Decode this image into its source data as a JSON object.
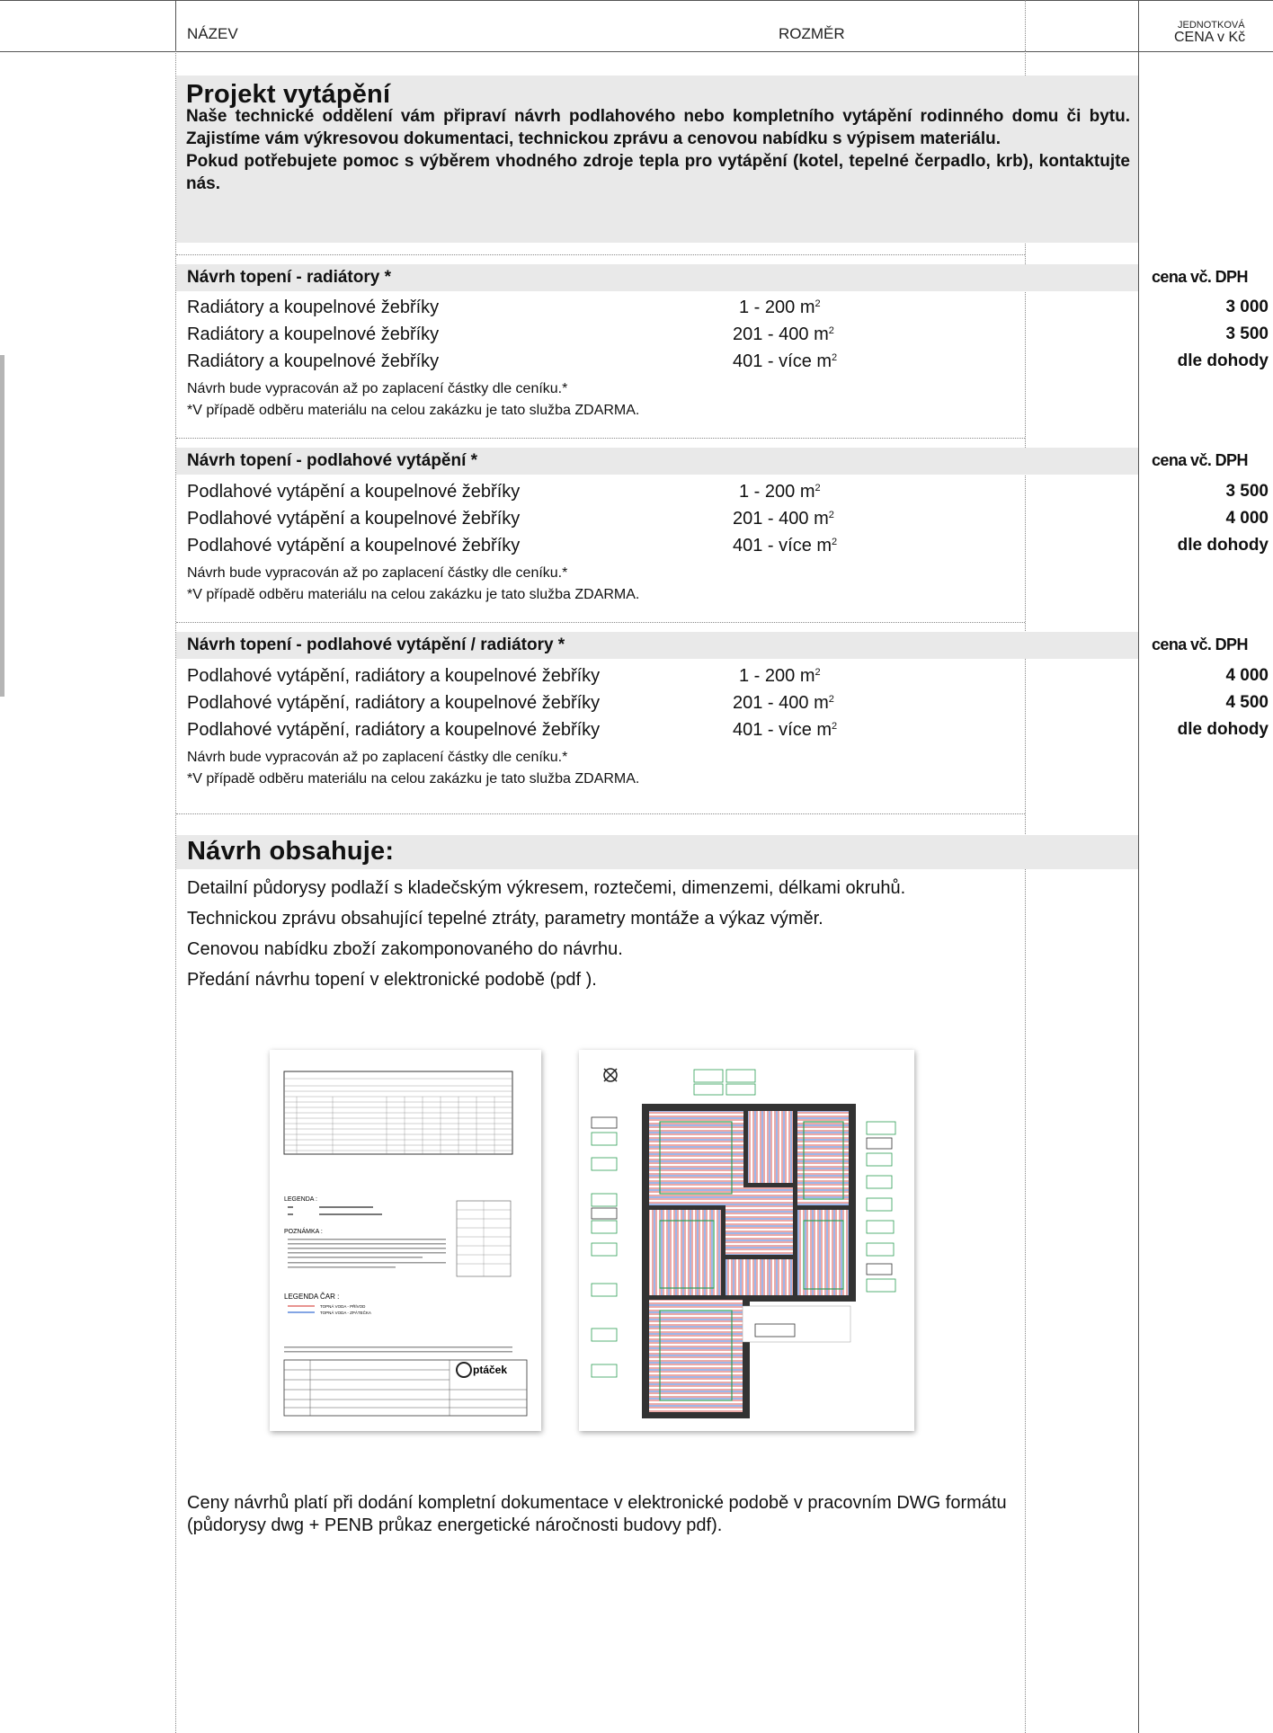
{
  "header": {
    "col_name": "NÁZEV",
    "col_size": "ROZMĚR",
    "col_price_line1": "JEDNOTKOVÁ",
    "col_price_line2": "CENA v Kč"
  },
  "project": {
    "title": "Projekt vytápění",
    "intro_p1": "Naše technické oddělení vám připraví návrh podlahového nebo kompletního vytápění rodinného domu či bytu. Zajistíme vám výkresovou dokumentaci, technickou zprávu a cenovou nabídku s výpisem materiálu.",
    "intro_p2": "Pokud potřebujete pomoc s výběrem vhodného zdroje tepla pro vytápění (kotel, tepelné čerpadlo, krb), kontaktujte nás."
  },
  "sections": [
    {
      "title": "Návrh topení - radiátory *",
      "price_header": "cena vč. DPH",
      "rows": [
        {
          "name": "Radiátory a koupelnové žebříky",
          "size": "1 - 200 m",
          "price": "3 000"
        },
        {
          "name": "Radiátory a koupelnové žebříky",
          "size": "201 - 400 m",
          "price": "3 500"
        },
        {
          "name": "Radiátory a koupelnové žebříky",
          "size": "401 - více m",
          "price": "dle dohody"
        }
      ],
      "note1": "Návrh bude vypracován až po zaplacení částky dle ceníku.*",
      "note2": "*V případě odběru materiálu na celou zakázku je tato služba ZDARMA."
    },
    {
      "title": "Návrh topení - podlahové vytápění *",
      "price_header": "cena vč. DPH",
      "rows": [
        {
          "name": "Podlahové vytápění a koupelnové žebříky",
          "size": "1 - 200 m",
          "price": "3 500"
        },
        {
          "name": "Podlahové vytápění a koupelnové žebříky",
          "size": "201 - 400 m",
          "price": "4 000"
        },
        {
          "name": "Podlahové vytápění a koupelnové žebříky",
          "size": "401 - více m",
          "price": "dle dohody"
        }
      ],
      "note1": "Návrh bude vypracován až po zaplacení částky dle ceníku.*",
      "note2": "*V případě odběru materiálu na celou zakázku je tato služba ZDARMA."
    },
    {
      "title": "Návrh topení - podlahové vytápění / radiátory *",
      "price_header": "cena vč. DPH",
      "rows": [
        {
          "name": "Podlahové vytápění, radiátory a koupelnové žebříky",
          "size": "1 - 200 m",
          "price": "4 000"
        },
        {
          "name": "Podlahové vytápění, radiátory a koupelnové žebříky",
          "size": "201 - 400 m",
          "price": "4 500"
        },
        {
          "name": "Podlahové vytápění, radiátory a koupelnové žebříky",
          "size": "401 - více m",
          "price": "dle dohody"
        }
      ],
      "note1": "Návrh bude vypracován až po zaplacení částky dle ceníku.*",
      "note2": "*V případě odběru materiálu na celou zakázku je tato služba ZDARMA."
    }
  ],
  "unit_superscript": "2",
  "contents": {
    "title": "Návrh obsahuje:",
    "items": [
      "Detailní půdorysy podlaží s kladečským výkresem, roztečemi, dimenzemi, délkami okruhů.",
      "Technickou zprávu obsahující tepelné ztráty, parametry montáže a výkaz výměr.",
      "Cenovou nabídku zboží zakomponovaného do návrhu.",
      "Předání návrhu topení v elektronické podobě (pdf )."
    ]
  },
  "sample_doc": {
    "legend_title": "LEGENDA :",
    "notes_title": "POZNÁMKA :",
    "lines_title": "LEGENDA ČAR :",
    "supply_line": "TOPNÁ VODA - PŘÍVOD",
    "return_line": "TOPNÁ VODA - ZPÁTEČKA",
    "logo": "ptáček"
  },
  "footer_text": "Ceny návrhů platí při dodání kompletní dokumentace v elektronické podobě v pracovním DWG formátu (půdorysy dwg + PENB průkaz energetické náročnosti budovy pdf).",
  "colors": {
    "band": "#e9e9e9",
    "rule": "#555555",
    "supply": "#d9534f",
    "return": "#3b6fd4",
    "zone": "#2e9d55"
  }
}
